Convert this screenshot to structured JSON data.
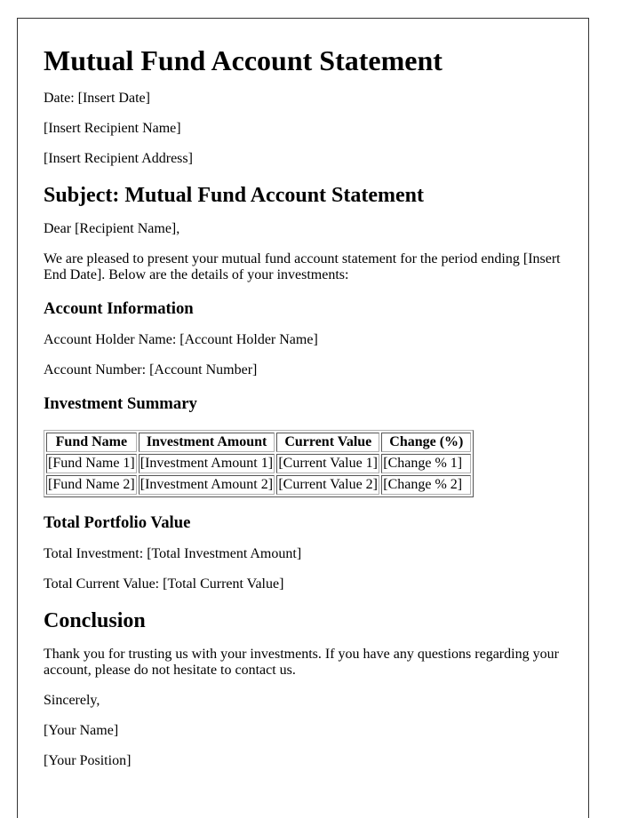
{
  "document": {
    "title": "Mutual Fund Account Statement",
    "date_line": "Date: [Insert Date]",
    "recipient_name": "[Insert Recipient Name]",
    "recipient_address": "[Insert Recipient Address]",
    "subject": "Subject: Mutual Fund Account Statement",
    "salutation": "Dear [Recipient Name],",
    "intro": "We are pleased to present your mutual fund account statement for the period ending [Insert End Date]. Below are the details of your investments:"
  },
  "account_information": {
    "heading": "Account Information",
    "holder_name": "Account Holder Name: [Account Holder Name]",
    "account_number": "Account Number: [Account Number]"
  },
  "investment_summary": {
    "heading": "Investment Summary",
    "columns": [
      "Fund Name",
      "Investment Amount",
      "Current Value",
      "Change (%)"
    ],
    "rows": [
      [
        "[Fund Name 1]",
        "[Investment Amount 1]",
        "[Current Value 1]",
        "[Change % 1]"
      ],
      [
        "[Fund Name 2]",
        "[Investment Amount 2]",
        "[Current Value 2]",
        "[Change % 2]"
      ]
    ]
  },
  "portfolio": {
    "heading": "Total Portfolio Value",
    "total_investment": "Total Investment: [Total Investment Amount]",
    "total_current_value": "Total Current Value: [Total Current Value]"
  },
  "conclusion": {
    "heading": "Conclusion",
    "body": "Thank you for trusting us with your investments. If you have any questions regarding your account, please do not hesitate to contact us.",
    "closing": "Sincerely,",
    "signer_name": "[Your Name]",
    "signer_position": "[Your Position]"
  }
}
